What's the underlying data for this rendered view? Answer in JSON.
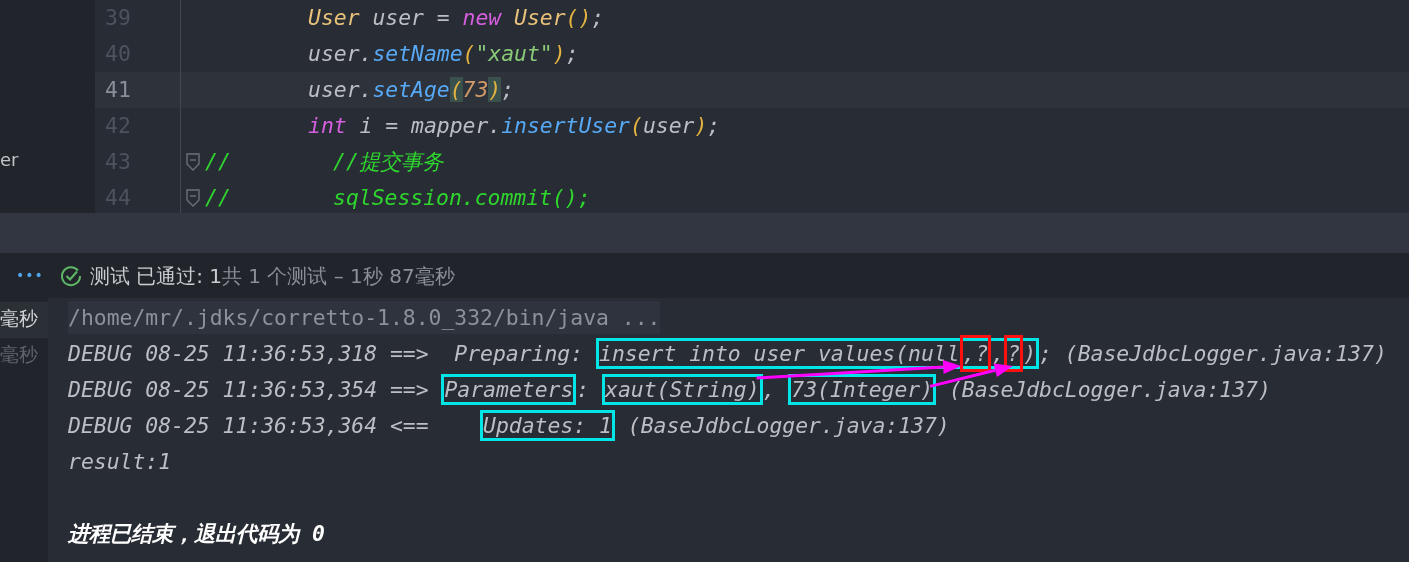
{
  "sidebar": {
    "label": "er"
  },
  "editor": {
    "lines": [
      {
        "number": "39",
        "current": false,
        "kind": "code",
        "foldable": false,
        "tokens": [
          {
            "text": "User",
            "kind": "class"
          },
          {
            "text": " user = ",
            "kind": "plain"
          },
          {
            "text": "new",
            "kind": "keyword"
          },
          {
            "text": " User",
            "kind": "class"
          },
          {
            "text": "()",
            "kind": "paren"
          },
          {
            "text": ";",
            "kind": "plain"
          }
        ]
      },
      {
        "number": "40",
        "current": false,
        "kind": "code",
        "foldable": false,
        "tokens": [
          {
            "text": "user.",
            "kind": "plain"
          },
          {
            "text": "setName",
            "kind": "method"
          },
          {
            "text": "(",
            "kind": "paren"
          },
          {
            "text": "\"xaut\"",
            "kind": "string"
          },
          {
            "text": ")",
            "kind": "paren"
          },
          {
            "text": ";",
            "kind": "plain"
          }
        ]
      },
      {
        "number": "41",
        "current": true,
        "kind": "code",
        "foldable": false,
        "tokens": [
          {
            "text": "user.",
            "kind": "plain"
          },
          {
            "text": "setAge",
            "kind": "method"
          },
          {
            "text": "(",
            "kind": "paren",
            "matched": true
          },
          {
            "text": "73",
            "kind": "number"
          },
          {
            "text": ")",
            "kind": "paren",
            "matched": true
          },
          {
            "text": ";",
            "kind": "plain"
          }
        ]
      },
      {
        "number": "42",
        "current": false,
        "kind": "code",
        "foldable": false,
        "tokens": [
          {
            "text": "int",
            "kind": "keyword"
          },
          {
            "text": " i = mapper.",
            "kind": "plain"
          },
          {
            "text": "insertUser",
            "kind": "method"
          },
          {
            "text": "(",
            "kind": "paren"
          },
          {
            "text": "user",
            "kind": "plain"
          },
          {
            "text": ")",
            "kind": "paren"
          },
          {
            "text": ";",
            "kind": "plain"
          }
        ]
      },
      {
        "number": "43",
        "current": false,
        "kind": "commented",
        "marker": "//",
        "foldable": true,
        "tokens": [
          {
            "text": "//提交事务",
            "kind": "comment"
          }
        ]
      },
      {
        "number": "44",
        "current": false,
        "kind": "commented",
        "marker": "//",
        "foldable": true,
        "tokens": [
          {
            "text": "sqlSession.commit();",
            "kind": "comment"
          }
        ]
      }
    ]
  },
  "test_bar": {
    "menu": "•••",
    "passed": true,
    "label": "测试 已通过: 1",
    "summary": "共 1 个测试 – 1秒 87毫秒"
  },
  "console": {
    "side_items": [
      {
        "label": "毫秒",
        "selected": true
      },
      {
        "label": "毫秒",
        "selected": false
      }
    ],
    "lines": [
      {
        "kind": "command",
        "segments": [
          {
            "text": "/home/mr/.jdks/corretto-1.8.0_332/bin/java ..."
          }
        ]
      },
      {
        "kind": "log",
        "segments": [
          {
            "text": "DEBUG 08-25 11:36:53,318 ==>  Preparing: "
          },
          {
            "color": "#00e5e5",
            "parts": [
              {
                "text": "insert into user values(null"
              },
              {
                "text": ",?",
                "color": "#ff1010",
                "arrow_target": true
              },
              {
                "text": ","
              },
              {
                "text": "?",
                "color": "#ff1010",
                "arrow_target": true
              },
              {
                "text": ")"
              }
            ]
          },
          {
            "text": "; (BaseJdbcLogger.java:137)"
          }
        ]
      },
      {
        "kind": "log",
        "segments": [
          {
            "text": "DEBUG 08-25 11:36:53,354 ==> "
          },
          {
            "text": "Parameters",
            "color": "#00e5e5"
          },
          {
            "text": ": "
          },
          {
            "text": "xaut(String)",
            "color": "#00e5e5",
            "arrow": true
          },
          {
            "text": ", "
          },
          {
            "text": "73(Integer)",
            "color": "#00e5e5",
            "arrow": true
          },
          {
            "text": " (BaseJdbcLogger.java:137)"
          }
        ]
      },
      {
        "kind": "log",
        "segments": [
          {
            "text": "DEBUG 08-25 11:36:53,364 <==    "
          },
          {
            "text": "Updates: 1",
            "color": "#00e5e5"
          },
          {
            "text": " (BaseJdbcLogger.java:137)"
          }
        ]
      },
      {
        "kind": "log",
        "segments": [
          {
            "text": "result:1"
          }
        ]
      },
      {
        "kind": "exit",
        "segments": [
          {
            "text": "进程已结束，退出代码为 0"
          }
        ]
      }
    ]
  }
}
